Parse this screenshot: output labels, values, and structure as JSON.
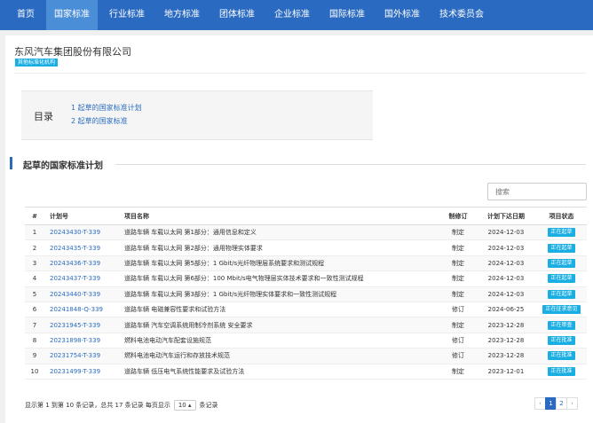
{
  "nav": {
    "items": [
      {
        "label": "首页",
        "active": false
      },
      {
        "label": "国家标准",
        "active": true
      },
      {
        "label": "行业标准",
        "active": false
      },
      {
        "label": "地方标准",
        "active": false
      },
      {
        "label": "团体标准",
        "active": false
      },
      {
        "label": "企业标准",
        "active": false
      },
      {
        "label": "国际标准",
        "active": false
      },
      {
        "label": "国外标准",
        "active": false
      },
      {
        "label": "技术委员会",
        "active": false
      }
    ]
  },
  "org": {
    "name": "东风汽车集团股份有限公司",
    "badge": "其他标准化机构"
  },
  "toc": {
    "title": "目录",
    "items": [
      "1 起草的国家标准计划",
      "2 起草的国家标准"
    ]
  },
  "section": {
    "title": "起草的国家标准计划"
  },
  "search": {
    "placeholder": "搜索"
  },
  "table": {
    "headers": {
      "num": "#",
      "code": "计划号",
      "name": "项目名称",
      "revision": "制修订",
      "date": "计划下达日期",
      "status": "项目状态"
    },
    "rows": [
      {
        "num": "1",
        "code": "20243430-T-339",
        "name": "道路车辆 车载以太网 第1部分：通用信息和定义",
        "revision": "制定",
        "date": "2024-12-03",
        "status": "正在起草"
      },
      {
        "num": "2",
        "code": "20243435-T-339",
        "name": "道路车辆 车载以太网 第2部分：通用物理实体要求",
        "revision": "制定",
        "date": "2024-12-03",
        "status": "正在起草"
      },
      {
        "num": "3",
        "code": "20243436-T-339",
        "name": "道路车辆 车载以太网 第5部分：1 Gbit/s光纤物理层系统要求和测试规程",
        "revision": "制定",
        "date": "2024-12-03",
        "status": "正在起草"
      },
      {
        "num": "4",
        "code": "20243437-T-339",
        "name": "道路车辆 车载以太网 第6部分：100 Mbit/s电气物理层实体技术要求和一致性测试规程",
        "revision": "制定",
        "date": "2024-12-03",
        "status": "正在起草"
      },
      {
        "num": "5",
        "code": "20243440-T-339",
        "name": "道路车辆 车载以太网 第3部分：1 Gbit/s光纤物理实体要求和一致性测试规程",
        "revision": "制定",
        "date": "2024-12-03",
        "status": "正在起草"
      },
      {
        "num": "6",
        "code": "20241848-Q-339",
        "name": "道路车辆 电磁兼容性要求和试验方法",
        "revision": "修订",
        "date": "2024-06-25",
        "status": "正在征求意见"
      },
      {
        "num": "7",
        "code": "20231945-T-339",
        "name": "道路车辆 汽车空调系统用制冷剂系统 安全要求",
        "revision": "制定",
        "date": "2023-12-28",
        "status": "正在审查"
      },
      {
        "num": "8",
        "code": "20231898-T-339",
        "name": "燃料电池电动汽车配套设施规范",
        "revision": "修订",
        "date": "2023-12-28",
        "status": "正在批准"
      },
      {
        "num": "9",
        "code": "20231754-T-339",
        "name": "燃料电池电动汽车运行和存放技术规范",
        "revision": "修订",
        "date": "2023-12-28",
        "status": "正在批准"
      },
      {
        "num": "10",
        "code": "20231499-T-339",
        "name": "道路车辆 低压电气系统性能要求及试验方法",
        "revision": "制定",
        "date": "2023-12-01",
        "status": "正在批准"
      }
    ]
  },
  "pager": {
    "info_prefix": "显示第 1 到第 10 条记录，总共 17 条记录 每页显示",
    "page_size": "10 ▴",
    "info_suffix": "条记录",
    "prev": "‹",
    "pages": [
      "1",
      "2"
    ],
    "next": "›"
  },
  "colors": {
    "nav_bg": "#2a6bc1",
    "nav_active": "#4b8ed8",
    "badge": "#1aaee3",
    "link": "#2a6bc1"
  }
}
